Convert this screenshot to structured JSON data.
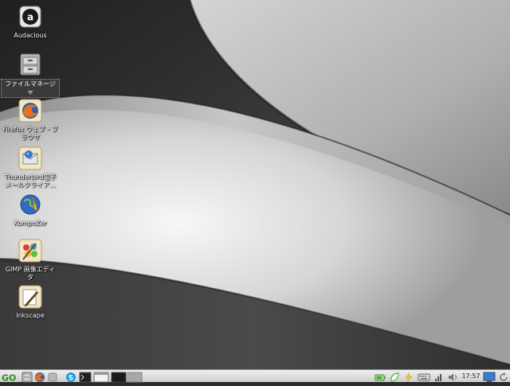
{
  "desktop": {
    "icons": [
      {
        "label": "Audacious",
        "icon": "audacious-icon"
      },
      {
        "label": "ファイルマネージャ",
        "icon": "file-manager-icon",
        "selected": true
      },
      {
        "label": "Firefox ウェブ・ブラウザ",
        "icon": "firefox-icon"
      },
      {
        "label": "Thunderbird電子メールクライア…",
        "icon": "thunderbird-icon"
      },
      {
        "label": "KompoZer",
        "icon": "kompozer-icon"
      },
      {
        "label": "GIMP 画像エディタ",
        "icon": "gimp-icon"
      },
      {
        "label": "Inkscape",
        "icon": "inkscape-icon"
      }
    ]
  },
  "taskbar": {
    "start_label": "GO",
    "launchers": [
      "file-manager-icon",
      "firefox-icon",
      "skype-icon",
      "terminal-icon",
      "window-icon",
      "desktop-icon"
    ],
    "tray": [
      "battery-icon",
      "leaf-icon",
      "bolt-icon",
      "keyboard-icon",
      "signal-icon",
      "volume-icon"
    ],
    "clock": "17:57",
    "end_icons": [
      "monitor-icon",
      "refresh-icon"
    ]
  },
  "colors": {
    "taskbar_bg": "#dcdcdc",
    "start_green": "#3a9a2a"
  }
}
